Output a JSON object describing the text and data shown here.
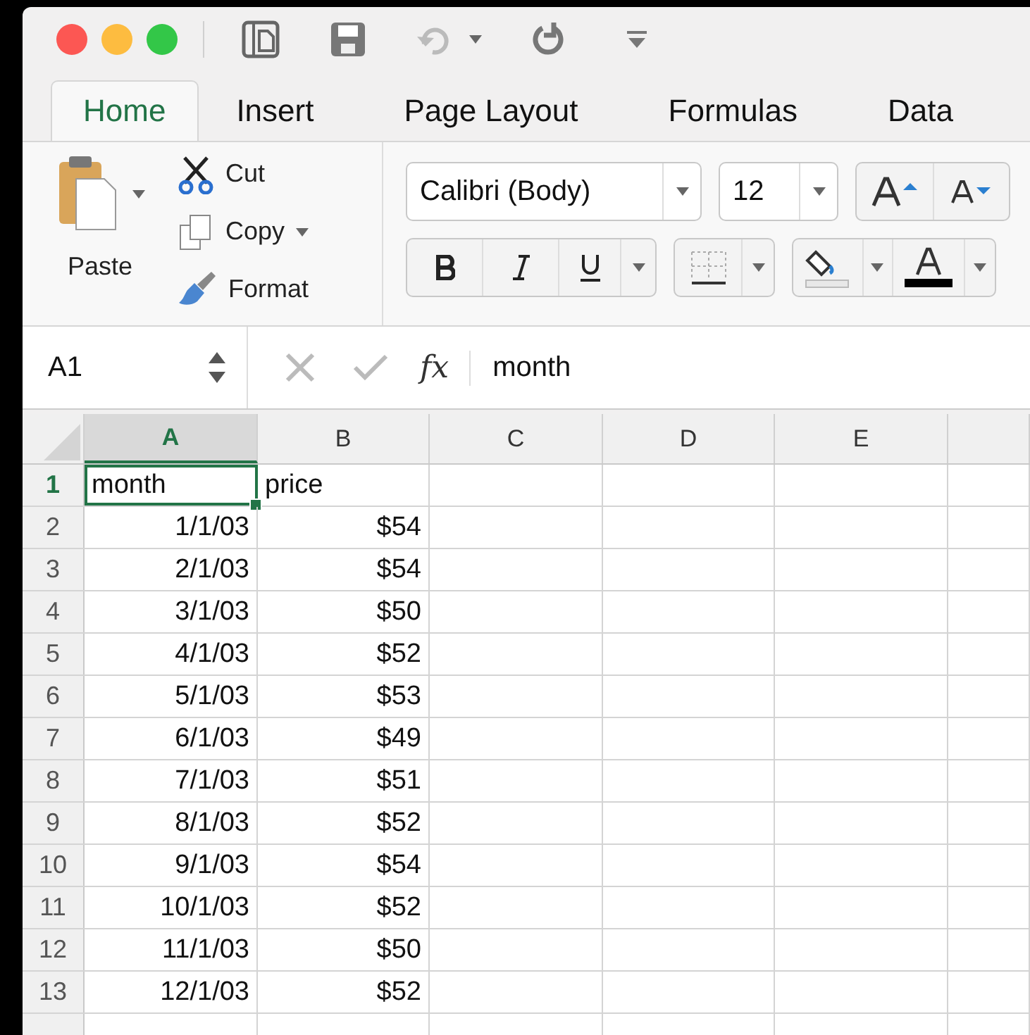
{
  "tabs": [
    {
      "label": "Home",
      "selected": true
    },
    {
      "label": "Insert",
      "selected": false
    },
    {
      "label": "Page Layout",
      "selected": false
    },
    {
      "label": "Formulas",
      "selected": false
    },
    {
      "label": "Data",
      "selected": false
    }
  ],
  "clipboard": {
    "paste": "Paste",
    "cut": "Cut",
    "copy": "Copy",
    "format": "Format"
  },
  "font": {
    "name": "Calibri (Body)",
    "size": "12"
  },
  "formula_bar": {
    "cell": "A1",
    "fx": "fx",
    "value": "month"
  },
  "columns": [
    {
      "label": "A",
      "selected": true
    },
    {
      "label": "B",
      "selected": false
    },
    {
      "label": "C",
      "selected": false
    },
    {
      "label": "D",
      "selected": false
    },
    {
      "label": "E",
      "selected": false
    }
  ],
  "rows": [
    {
      "num": "1",
      "cells": [
        "month",
        "price"
      ],
      "selected": true,
      "kind": "header"
    },
    {
      "num": "2",
      "cells": [
        "1/1/03",
        "$54"
      ],
      "selected": false,
      "kind": "data"
    },
    {
      "num": "3",
      "cells": [
        "2/1/03",
        "$54"
      ],
      "selected": false,
      "kind": "data"
    },
    {
      "num": "4",
      "cells": [
        "3/1/03",
        "$50"
      ],
      "selected": false,
      "kind": "data"
    },
    {
      "num": "5",
      "cells": [
        "4/1/03",
        "$52"
      ],
      "selected": false,
      "kind": "data"
    },
    {
      "num": "6",
      "cells": [
        "5/1/03",
        "$53"
      ],
      "selected": false,
      "kind": "data"
    },
    {
      "num": "7",
      "cells": [
        "6/1/03",
        "$49"
      ],
      "selected": false,
      "kind": "data"
    },
    {
      "num": "8",
      "cells": [
        "7/1/03",
        "$51"
      ],
      "selected": false,
      "kind": "data"
    },
    {
      "num": "9",
      "cells": [
        "8/1/03",
        "$52"
      ],
      "selected": false,
      "kind": "data"
    },
    {
      "num": "10",
      "cells": [
        "9/1/03",
        "$54"
      ],
      "selected": false,
      "kind": "data"
    },
    {
      "num": "11",
      "cells": [
        "10/1/03",
        "$52"
      ],
      "selected": false,
      "kind": "data"
    },
    {
      "num": "12",
      "cells": [
        "11/1/03",
        "$50"
      ],
      "selected": false,
      "kind": "data"
    },
    {
      "num": "13",
      "cells": [
        "12/1/03",
        "$52"
      ],
      "selected": false,
      "kind": "data"
    }
  ]
}
